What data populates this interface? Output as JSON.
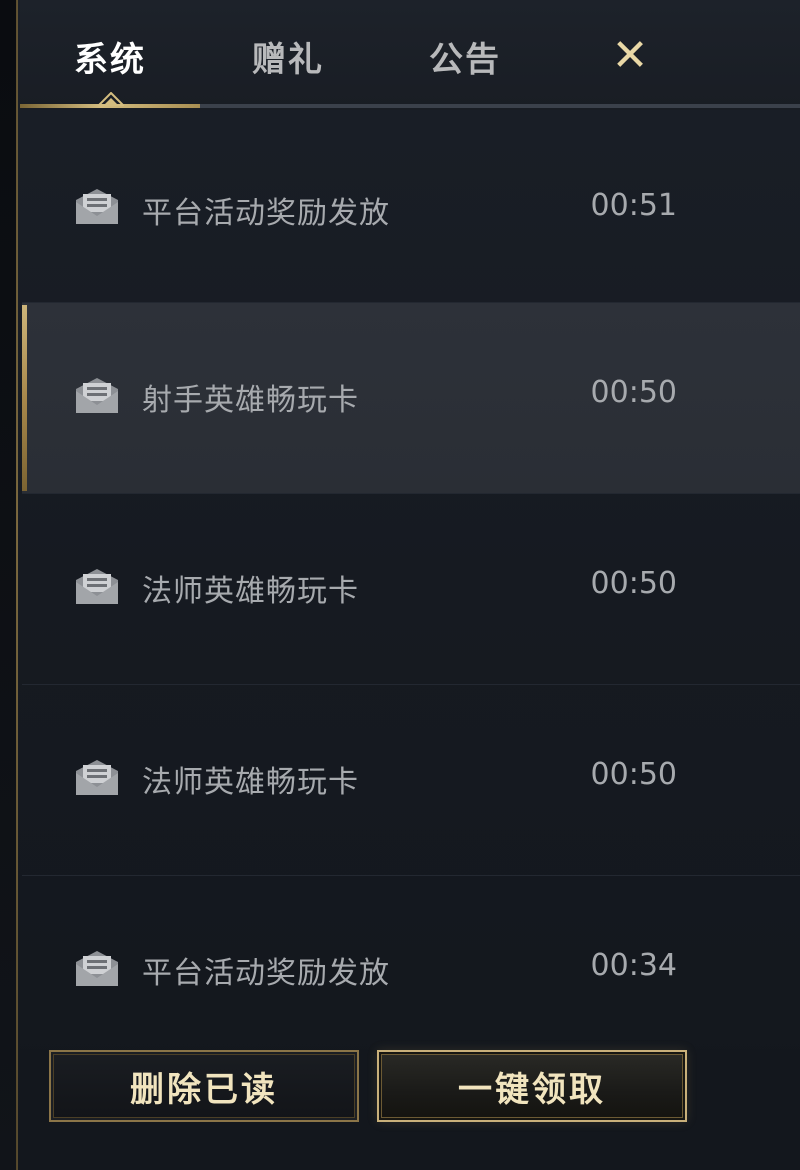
{
  "tabs": [
    {
      "label": "系统",
      "active": true
    },
    {
      "label": "赠礼",
      "active": false
    },
    {
      "label": "公告",
      "active": false
    }
  ],
  "close": {
    "glyph": "✕"
  },
  "mails": [
    {
      "title": "平台活动奖励发放",
      "time": "00:51",
      "selected": false
    },
    {
      "title": "射手英雄畅玩卡",
      "time": "00:50",
      "selected": true
    },
    {
      "title": "法师英雄畅玩卡",
      "time": "00:50",
      "selected": false
    },
    {
      "title": "法师英雄畅玩卡",
      "time": "00:50",
      "selected": false
    },
    {
      "title": "平台活动奖励发放",
      "time": "00:34",
      "selected": false
    }
  ],
  "buttons": {
    "delete_read": "删除已读",
    "claim_all": "一键领取"
  },
  "colors": {
    "gold": "#d4bd7f",
    "text_muted": "#a7aaae",
    "background": "#161a21"
  },
  "icons": {
    "mail": "mail-open-icon",
    "close": "close-icon",
    "caret": "caret-up-icon"
  }
}
